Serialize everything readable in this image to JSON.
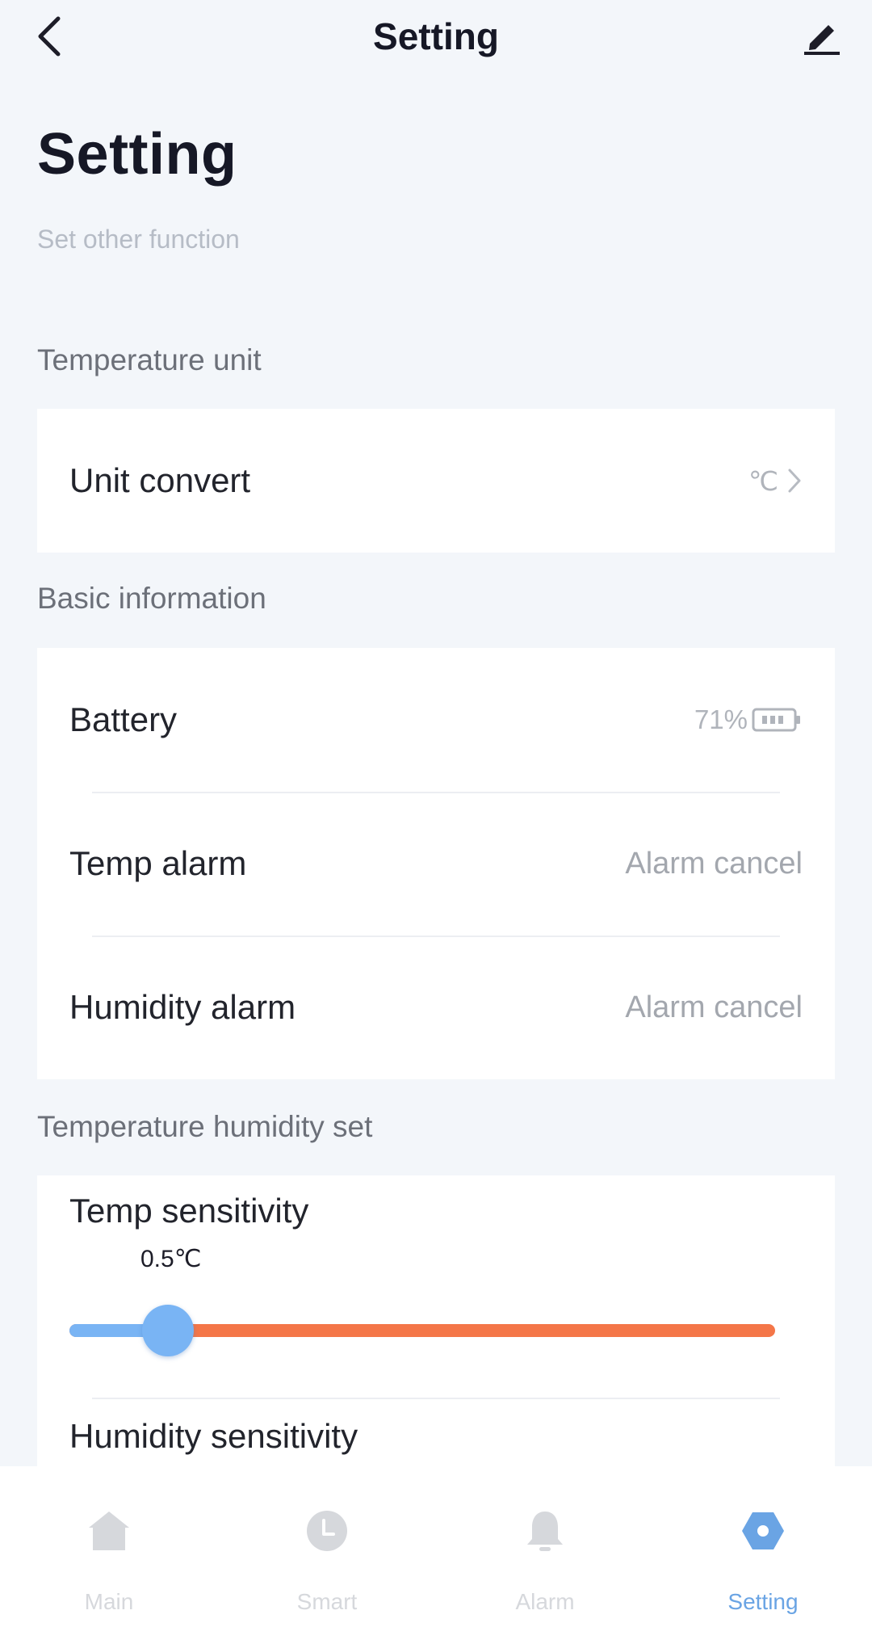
{
  "topbar": {
    "title": "Setting"
  },
  "header": {
    "title": "Setting",
    "subtitle": "Set other function"
  },
  "sections": {
    "temperature_unit": {
      "label": "Temperature unit",
      "unit_convert": {
        "label": "Unit convert",
        "value": "℃"
      }
    },
    "basic_information": {
      "label": "Basic information",
      "battery": {
        "label": "Battery",
        "value": "71%",
        "level": 0.71
      },
      "temp_alarm": {
        "label": "Temp alarm",
        "value": "Alarm cancel"
      },
      "humidity_alarm": {
        "label": "Humidity alarm",
        "value": "Alarm cancel"
      }
    },
    "temperature_humidity_set": {
      "label": "Temperature humidity set",
      "temp_sensitivity": {
        "label": "Temp sensitivity",
        "value": "0.5℃",
        "fraction": 0.14
      },
      "humidity_sensitivity": {
        "label": "Humidity sensitivity"
      }
    }
  },
  "tabbar": {
    "tabs": [
      {
        "id": "main",
        "label": "Main",
        "icon": "home-icon"
      },
      {
        "id": "smart",
        "label": "Smart",
        "icon": "clock-icon"
      },
      {
        "id": "alarm",
        "label": "Alarm",
        "icon": "bell-icon"
      },
      {
        "id": "setting",
        "label": "Setting",
        "icon": "hexagon-settings-icon"
      }
    ],
    "active": "setting"
  },
  "colors": {
    "background": "#f3f6fa",
    "card": "#ffffff",
    "accent_blue": "#79b4f4",
    "slider_track": "#f47648",
    "active_tab": "#6aa4e4",
    "inactive_tab": "#d6d8dc"
  }
}
